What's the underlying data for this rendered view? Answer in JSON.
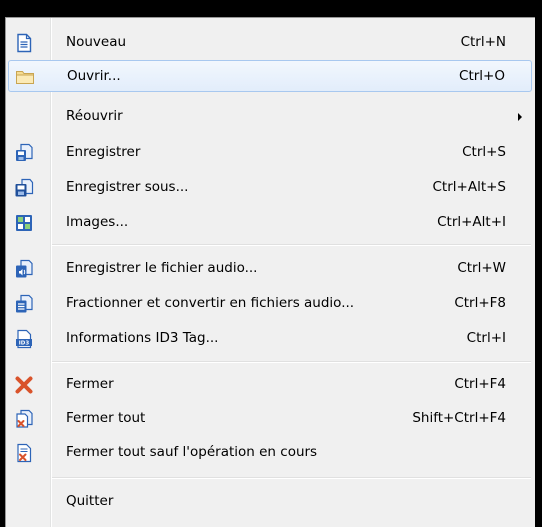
{
  "menu": {
    "items": [
      {
        "label": "Nouveau",
        "shortcut": "Ctrl+N",
        "icon": "new-document-icon"
      },
      {
        "label": "Ouvrir...",
        "shortcut": "Ctrl+O",
        "icon": "folder-icon"
      },
      {
        "label": "Réouvrir",
        "shortcut": "",
        "icon": "",
        "submenu": true
      },
      {
        "label": "Enregistrer",
        "shortcut": "Ctrl+S",
        "icon": "save-icon"
      },
      {
        "label": "Enregistrer sous...",
        "shortcut": "Ctrl+Alt+S",
        "icon": "save-as-icon"
      },
      {
        "label": "Images...",
        "shortcut": "Ctrl+Alt+I",
        "icon": "images-icon"
      },
      {
        "label": "Enregistrer le fichier audio...",
        "shortcut": "Ctrl+W",
        "icon": "save-audio-icon"
      },
      {
        "label": "Fractionner et convertir en fichiers audio...",
        "shortcut": "Ctrl+F8",
        "icon": "split-convert-icon"
      },
      {
        "label": "Informations ID3 Tag...",
        "shortcut": "Ctrl+I",
        "icon": "id3-tag-icon"
      },
      {
        "label": "Fermer",
        "shortcut": "Ctrl+F4",
        "icon": "close-x-icon"
      },
      {
        "label": "Fermer tout",
        "shortcut": "Shift+Ctrl+F4",
        "icon": "close-all-icon"
      },
      {
        "label": "Fermer tout sauf l'opération en cours",
        "shortcut": "",
        "icon": "close-others-icon"
      },
      {
        "label": "Quitter",
        "shortcut": "",
        "icon": ""
      }
    ]
  },
  "colors": {
    "menu_bg": "#f0f0f0",
    "highlight_border": "#a8c8ef",
    "close_x": "#d9532b",
    "doc_blue": "#2d64b7"
  }
}
